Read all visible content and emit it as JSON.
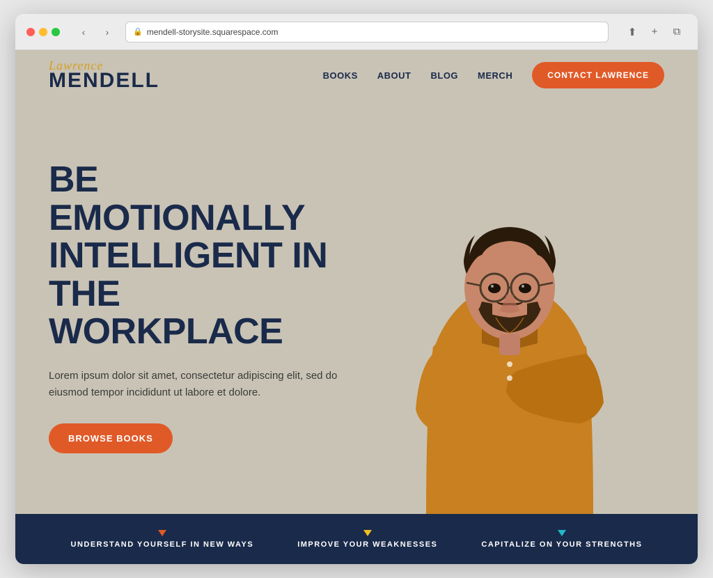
{
  "browser": {
    "url": "mendell-storysite.squarespace.com",
    "back_btn": "‹",
    "forward_btn": "›"
  },
  "header": {
    "logo_script": "Lawrence",
    "logo_bold": "MENDELL",
    "nav": {
      "items": [
        {
          "label": "BOOKS",
          "id": "books"
        },
        {
          "label": "ABOUT",
          "id": "about"
        },
        {
          "label": "BLOG",
          "id": "blog"
        },
        {
          "label": "MERCH",
          "id": "merch"
        }
      ],
      "contact_btn": "CONTACT LAWRENCE"
    }
  },
  "hero": {
    "headline": "BE EMOTIONALLY INTELLIGENT IN THE WORKPLACE",
    "subtext": "Lorem ipsum dolor sit amet, consectetur adipiscing elit, sed do eiusmod tempor incididunt ut labore et dolore.",
    "browse_btn": "BROWSE BOOKS"
  },
  "bottom_banner": {
    "items": [
      {
        "label": "UNDERSTAND YOURSELF IN NEW WAYS",
        "triangle_color": "orange"
      },
      {
        "label": "IMPROVE YOUR WEAKNESSES",
        "triangle_color": "yellow"
      },
      {
        "label": "CAPITALIZE ON YOUR STRENGTHS",
        "triangle_color": "teal"
      }
    ]
  },
  "colors": {
    "bg_hero": "#c9c3b5",
    "navy": "#1a2a4a",
    "orange": "#e05a28",
    "gold": "#d4a020",
    "banner_bg": "#1a2a4a"
  }
}
